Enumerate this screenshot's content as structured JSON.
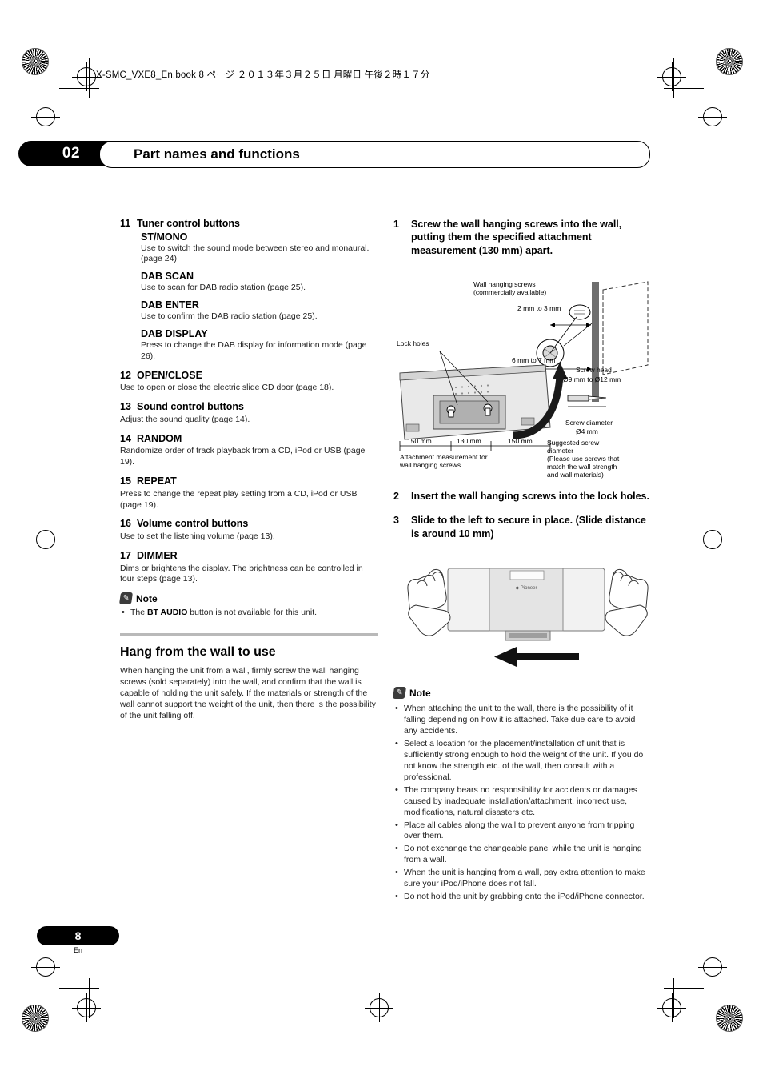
{
  "print_marks": {
    "file_line": "X-SMC_VXE8_En.book   8 ページ   ２０１３年３月２５日   月曜日   午後２時１７分"
  },
  "chapter": {
    "number": "02",
    "title": "Part names and functions"
  },
  "left_column": {
    "items": [
      {
        "number": "11",
        "title": "Tuner control buttons",
        "subitems": [
          {
            "title": "ST/MONO",
            "text": "Use to switch the sound mode between stereo and monaural. (page 24)"
          },
          {
            "title": "DAB SCAN",
            "text": "Use to scan for DAB radio station (page 25)."
          },
          {
            "title": "DAB ENTER",
            "text": "Use to confirm the DAB radio station (page 25)."
          },
          {
            "title": "DAB DISPLAY",
            "text": "Press to change the DAB display for information mode (page 26)."
          }
        ]
      },
      {
        "number": "12",
        "title": "OPEN/CLOSE",
        "text": "Use to open or close the electric slide CD door (page 18)."
      },
      {
        "number": "13",
        "title": "Sound control buttons",
        "text": "Adjust the sound quality (page 14)."
      },
      {
        "number": "14",
        "title": "RANDOM",
        "text": "Randomize order of track playback from a CD, iPod or USB (page 19)."
      },
      {
        "number": "15",
        "title": "REPEAT",
        "text": "Press to change the repeat play setting from a CD, iPod or USB (page 19)."
      },
      {
        "number": "16",
        "title": "Volume control buttons",
        "text": "Use to set the listening volume (page 13)."
      },
      {
        "number": "17",
        "title": "DIMMER",
        "text": "Dims or brightens the display. The brightness can be controlled in four steps (page 13)."
      }
    ],
    "note": {
      "label": "Note",
      "bullets": [
        {
          "pre": "The ",
          "bold": "BT AUDIO",
          "post": " button is not available for this unit."
        }
      ]
    },
    "section": {
      "title": "Hang from the wall to use",
      "text": "When hanging the unit from a wall, firmly screw the wall hanging screws (sold separately) into the wall, and confirm that the wall is capable of holding the unit safely. If the materials or strength of the wall cannot support the weight of the unit, then there is the possibility of the unit falling off."
    }
  },
  "right_column": {
    "steps": [
      {
        "number": "1",
        "text": "Screw the wall hanging screws into the wall, putting them the specified attachment measurement (130 mm) apart."
      },
      {
        "number": "2",
        "text": "Insert the wall hanging screws into the lock holes."
      },
      {
        "number": "3",
        "text": "Slide to the left to secure in place. (Slide distance is around 10 mm)"
      }
    ],
    "figure1_labels": {
      "wall_screws": "Wall hanging screws\n(commercially available)",
      "dim_2_3": "2 mm to 3 mm",
      "dim_6_7": "6 mm to 7 mm",
      "lock_holes": "Lock holes",
      "screw_head": "Screw head",
      "screw_head_dim": "Ø9 mm to Ø12 mm",
      "screw_diameter": "Screw diameter",
      "screw_diameter_dim": "Ø4 mm",
      "dim_left": "150 mm",
      "dim_center": "130 mm",
      "dim_right": "150 mm",
      "attachment": "Attachment measurement for\nwall hanging screws",
      "suggested": "Suggested screw\ndiameter\n(Please use screws that\nmatch the wall strength\nand wall materials)"
    },
    "note": {
      "label": "Note",
      "bullets": [
        "When attaching the unit to the wall, there is the possibility of it falling depending on how it is attached. Take due care to avoid any accidents.",
        "Select a location for the placement/installation of unit that is sufficiently strong enough to hold the weight of the unit. If you do not know the strength etc. of the wall, then consult with a professional.",
        "The company bears no responsibility for accidents or damages caused by inadequate installation/attachment, incorrect use, modifications, natural disasters etc.",
        "Place all cables along the wall to prevent anyone from tripping over them.",
        "Do not exchange the changeable panel while the unit is hanging from a wall.",
        "When the unit is hanging from a wall, pay extra attention to make sure your iPod/iPhone does not fall.",
        "Do not hold the unit by grabbing onto the iPod/iPhone connector."
      ]
    }
  },
  "footer": {
    "page_number": "8",
    "language": "En"
  }
}
